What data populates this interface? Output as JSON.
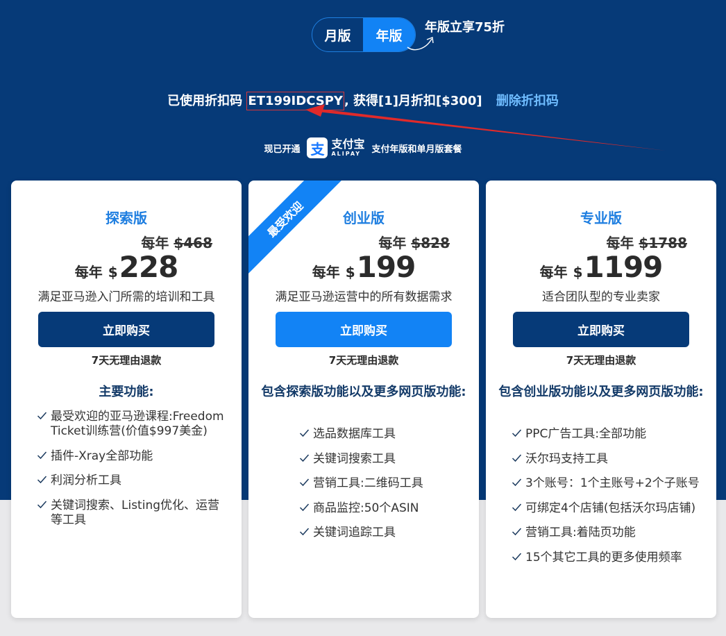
{
  "toggle": {
    "monthly": "月版",
    "yearly": "年版",
    "promo": "年版立享75折"
  },
  "coupon": {
    "prefix": "已使用折扣码 ",
    "code": "ET199IDCSPY",
    "suffix": ", 获得[1]月折扣[$300]",
    "remove": "删除折扣码"
  },
  "alipay": {
    "prefix": "现已开通",
    "logo_cn": "支付宝",
    "logo_en": "ALIPAY",
    "logo_glyph": "支",
    "suffix": "支付年版和单月版套餐"
  },
  "plans": [
    {
      "name": "探索版",
      "per": "每年",
      "orig_currency": "$",
      "orig_amount": "468",
      "currency": "$",
      "amount": "228",
      "tagline": "满足亚马逊入门所需的培训和工具",
      "buy": "立即购买",
      "refund": "7天无理由退款",
      "features_title": "主要功能:",
      "features": [
        "最受欢迎的亚马逊课程:Freedom Ticket训练营(价值$997美金)",
        "插件-Xray全部功能",
        "利润分析工具",
        "关键词搜索、Listing优化、运营等工具"
      ]
    },
    {
      "name": "创业版",
      "ribbon": "最受欢迎",
      "per": "每年",
      "orig_currency": "$",
      "orig_amount": "828",
      "currency": "$",
      "amount": "199",
      "tagline": "满足亚马逊运营中的所有数据需求",
      "buy": "立即购买",
      "refund": "7天无理由退款",
      "features_title": "包含探索版功能以及更多网页版功能:",
      "features": [
        "选品数据库工具",
        "关键词搜索工具",
        "营销工具:二维码工具",
        "商品监控:50个ASIN",
        "关键词追踪工具"
      ]
    },
    {
      "name": "专业版",
      "per": "每年",
      "orig_currency": "$",
      "orig_amount": "1788",
      "currency": "$",
      "amount": "1199",
      "tagline": "适合团队型的专业卖家",
      "buy": "立即购买",
      "refund": "7天无理由退款",
      "features_title": "包含创业版功能以及更多网页版功能:",
      "features": [
        "PPC广告工具:全部功能",
        "沃尔玛支持工具",
        "3个账号：1个主账号+2个子账号",
        "可绑定4个店铺(包括沃尔玛店铺)",
        "营销工具:着陆页功能",
        "15个其它工具的更多使用频率"
      ]
    }
  ],
  "colors": {
    "navy": "#063a78",
    "accent_blue": "#1283f5",
    "link_blue": "#6fbcff",
    "highlight_red": "#d6363a"
  }
}
